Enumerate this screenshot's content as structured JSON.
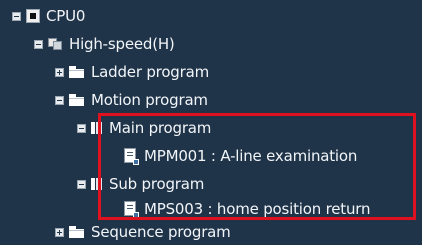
{
  "tree": {
    "root": {
      "label": "CPU0",
      "icon": "cpu-icon"
    },
    "speed": {
      "label": "High-speed(H)",
      "icon": "highspeed-icon"
    },
    "ladder": {
      "label": "Ladder program",
      "icon": "folder-icon"
    },
    "motion": {
      "label": "Motion program",
      "icon": "folder-icon"
    },
    "main_program": {
      "label": "Main program",
      "icon": "program-folder-icon"
    },
    "main_item": {
      "label": "MPM001 : A-line examination",
      "icon": "program-file-icon"
    },
    "sub_program": {
      "label": "Sub program",
      "icon": "program-folder-icon"
    },
    "sub_item": {
      "label": "MPS003 : home position return",
      "icon": "program-file-icon"
    },
    "sequence": {
      "label": "Sequence program",
      "icon": "folder-icon"
    }
  },
  "colors": {
    "background": "#1f3349",
    "text": "#f2f5f8",
    "highlight_border": "#e0111f"
  }
}
